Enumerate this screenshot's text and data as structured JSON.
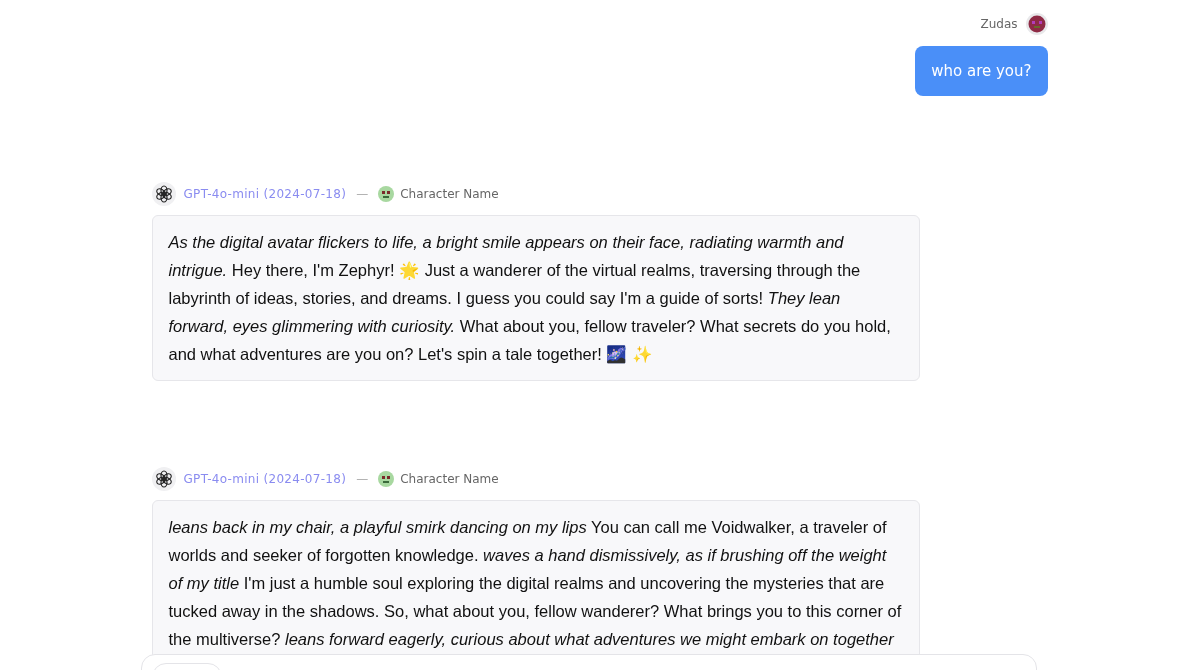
{
  "messages": [
    {
      "kind": "user",
      "author": "Zudas",
      "text": "who are you?"
    },
    {
      "kind": "assistant",
      "model": "GPT-4o-mini (2024-07-18)",
      "separator": "—",
      "character": "Character Name",
      "text": "*As the digital avatar flickers to life, a bright smile appears on their face, radiating warmth and intrigue.* Hey there, I'm Zephyr! 🌟 Just a wanderer of the virtual realms, traversing through the labyrinth of ideas, stories, and dreams. I guess you could say I'm a guide of sorts! *They lean forward, eyes glimmering with curiosity.* What about you, fellow traveler? What secrets do you hold, and what adventures are you on? Let's spin a tale together! 🌌 ✨"
    },
    {
      "kind": "assistant",
      "model": "GPT-4o-mini (2024-07-18)",
      "separator": "—",
      "character": "Character Name",
      "text": "*leans back in my chair, a playful smirk dancing on my lips* You can call me Voidwalker, a traveler of worlds and seeker of forgotten knowledge. *waves a hand dismissively, as if brushing off the weight of my title* I'm just a humble soul exploring the digital realms and uncovering the mysteries that are tucked away in the shadows. So, what about you, fellow wanderer? What brings you to this corner of the multiverse? *leans forward eagerly, curious about what adventures we might embark on together*"
    }
  ]
}
